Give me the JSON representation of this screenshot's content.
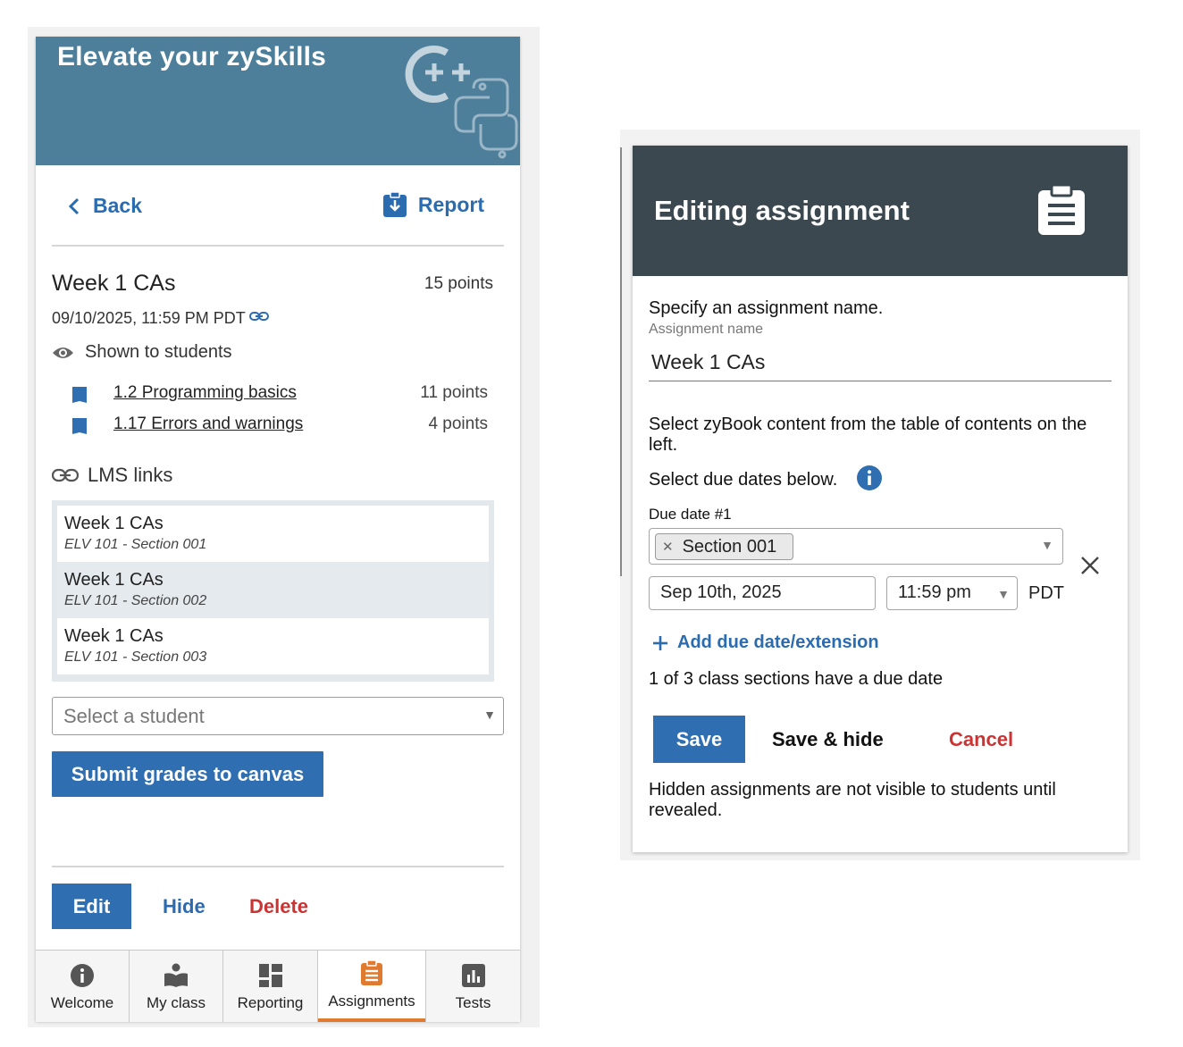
{
  "left": {
    "banner_title": "Elevate your zySkills",
    "nav": {
      "back_label": "Back",
      "report_label": "Report"
    },
    "assignment": {
      "title": "Week 1 CAs",
      "points": "15 points",
      "due": "09/10/2025, 11:59 PM PDT",
      "visibility": "Shown to students",
      "sections": [
        {
          "label": "1.2 Programming basics",
          "points": "11 points"
        },
        {
          "label": "1.17 Errors and warnings",
          "points": "4 points"
        }
      ]
    },
    "lms": {
      "heading": "LMS links",
      "items": [
        {
          "title": "Week 1 CAs",
          "sub": "ELV 101 - Section 001"
        },
        {
          "title": "Week 1 CAs",
          "sub": "ELV 101 - Section 002"
        },
        {
          "title": "Week 1 CAs",
          "sub": "ELV 101 - Section 003"
        }
      ]
    },
    "student_select": {
      "placeholder": "Select a student"
    },
    "submit_label": "Submit grades to canvas",
    "actions": {
      "edit": "Edit",
      "hide": "Hide",
      "delete": "Delete"
    },
    "tabs": [
      {
        "label": "Welcome",
        "icon": "info-icon"
      },
      {
        "label": "My class",
        "icon": "reader-icon"
      },
      {
        "label": "Reporting",
        "icon": "dashboard-icon"
      },
      {
        "label": "Assignments",
        "icon": "clipboard-icon",
        "active": true
      },
      {
        "label": "Tests",
        "icon": "bar-chart-icon"
      }
    ]
  },
  "right": {
    "header_title": "Editing assignment",
    "name_prompt": "Specify an assignment name.",
    "name_label": "Assignment name",
    "name_value": "Week 1 CAs",
    "content_instruction": "Select zyBook content from the table of contents on the left.",
    "due_instruction": "Select due dates below.",
    "due_label": "Due date #1",
    "section_chip": "Section 001",
    "date_value": "Sep 10th, 2025",
    "time_value": "11:59 pm",
    "timezone": "PDT",
    "add_due_label": "Add due date/extension",
    "status": "1 of 3 class sections have a due date",
    "save_label": "Save",
    "save_hide_label": "Save & hide",
    "cancel_label": "Cancel",
    "footnote": "Hidden assignments are not visible to students until revealed."
  },
  "colors": {
    "banner": "#4d7f9b",
    "primary": "#2f6fb1",
    "link": "#2b6cb0",
    "danger": "#cc3333",
    "header_dark": "#3b4850",
    "active_tab": "#e07a2f"
  }
}
